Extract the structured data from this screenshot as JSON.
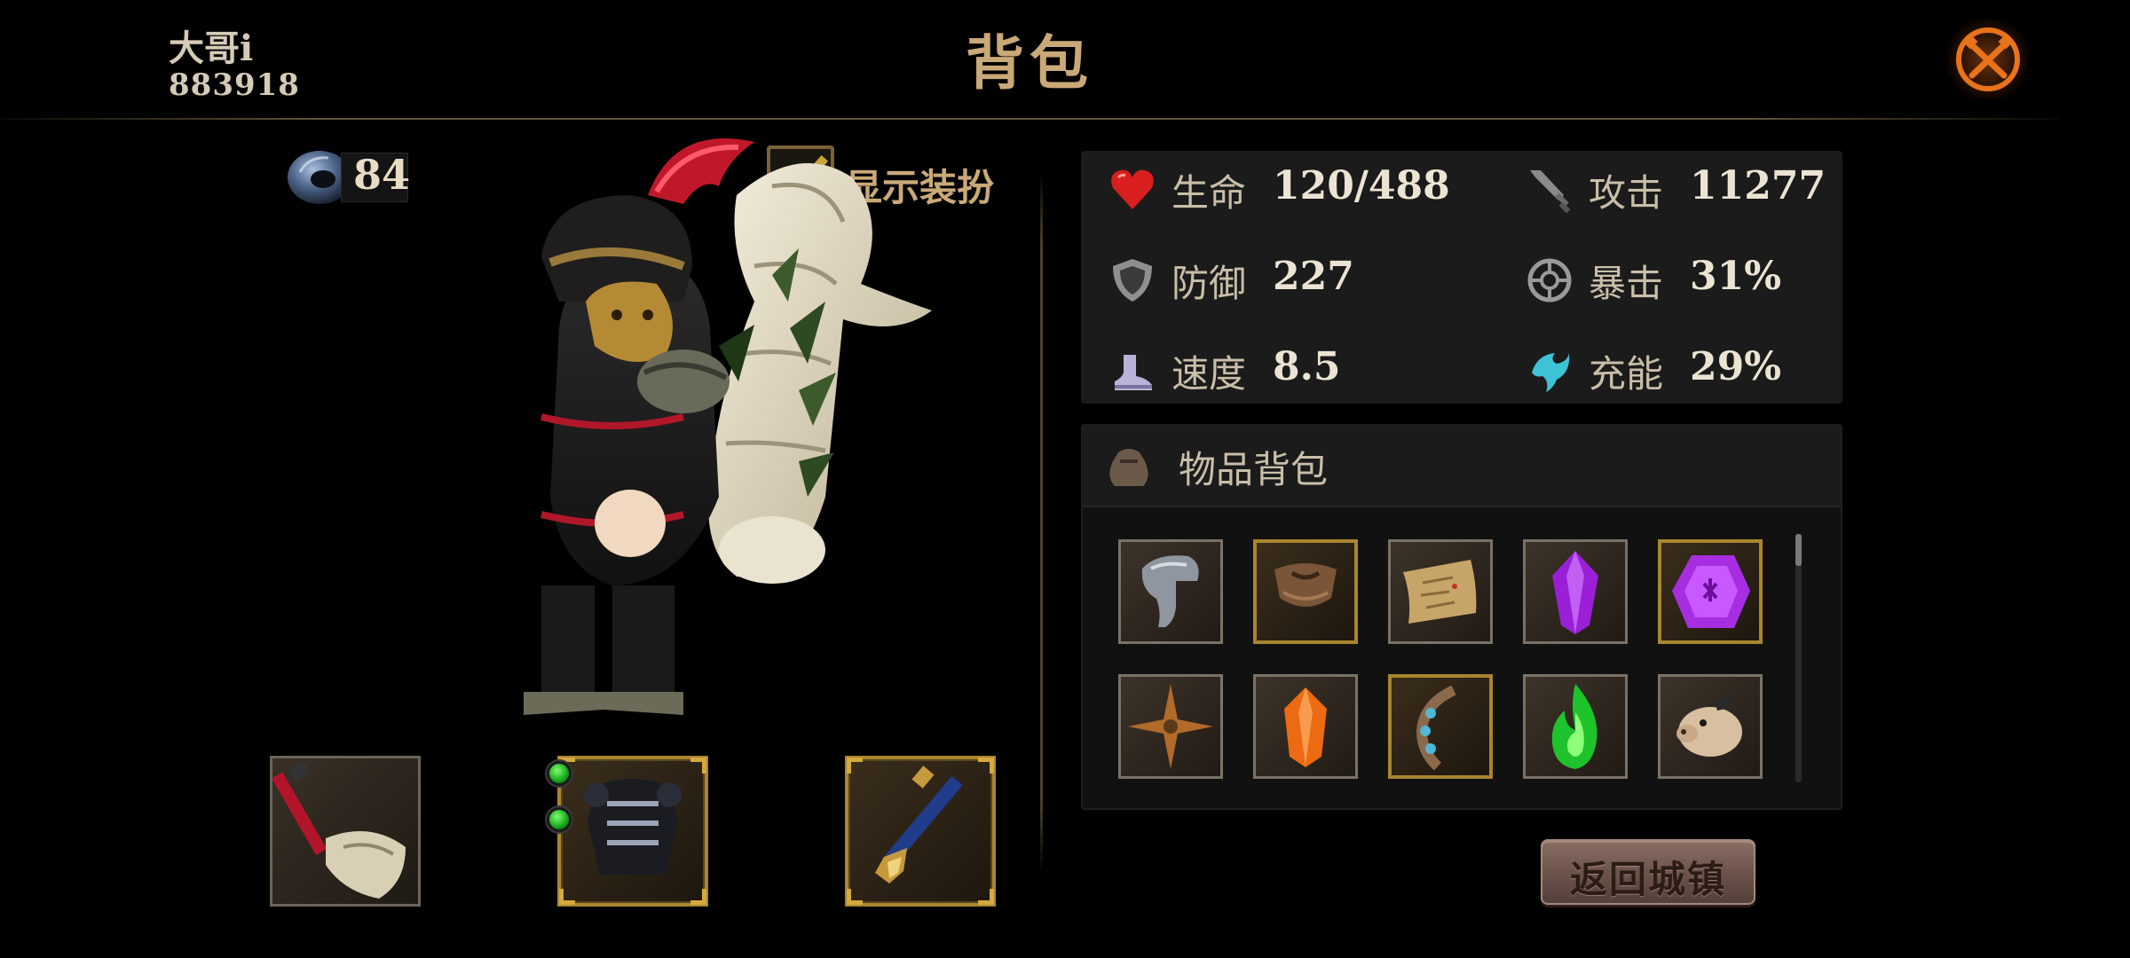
{
  "header": {
    "player_name": "大哥i",
    "player_id": "883918",
    "title": "背包"
  },
  "currency": {
    "icon": "stone-ring-icon",
    "count": "84"
  },
  "costume_toggle": {
    "label": "显示装扮",
    "checked": true
  },
  "equipment_slots": [
    {
      "name": "weapon-slot",
      "icon": "bone-axe-icon"
    },
    {
      "name": "armor-slot",
      "icon": "black-armor-icon",
      "sockets": 2
    },
    {
      "name": "accessory-slot",
      "icon": "blue-staff-icon"
    }
  ],
  "stats": [
    {
      "icon": "heart-icon",
      "label": "生命",
      "value": "120/488"
    },
    {
      "icon": "sword-icon",
      "label": "攻击",
      "value": "11277"
    },
    {
      "icon": "shield-icon",
      "label": "防御",
      "value": "227"
    },
    {
      "icon": "crit-icon",
      "label": "暴击",
      "value": "31%"
    },
    {
      "icon": "boot-icon",
      "label": "速度",
      "value": "8.5"
    },
    {
      "icon": "energy-icon",
      "label": "充能",
      "value": "29%"
    }
  ],
  "inventory": {
    "label": "物品背包",
    "items": [
      {
        "icon": "iron-helmet-icon",
        "frame": "plain"
      },
      {
        "icon": "leather-cloak-icon",
        "frame": "gold"
      },
      {
        "icon": "scroll-map-icon",
        "frame": "plain"
      },
      {
        "icon": "purple-crystal-icon",
        "frame": "plain"
      },
      {
        "icon": "purple-rune-gem-icon",
        "frame": "gold"
      },
      {
        "icon": "bronze-shuriken-icon",
        "frame": "plain"
      },
      {
        "icon": "orange-crystal-icon",
        "frame": "plain"
      },
      {
        "icon": "gem-bracelet-icon",
        "frame": "gold"
      },
      {
        "icon": "green-flame-icon",
        "frame": "plain"
      },
      {
        "icon": "pig-pet-icon",
        "frame": "plain"
      }
    ]
  },
  "return_button": {
    "label": "返回城镇"
  },
  "colors": {
    "title_gold": "#c9a977",
    "gold_frame": "#a8852f",
    "panel_bg": "#1b1b1b",
    "heart_red": "#d81e1e",
    "energy_cyan": "#3ec3d6"
  }
}
